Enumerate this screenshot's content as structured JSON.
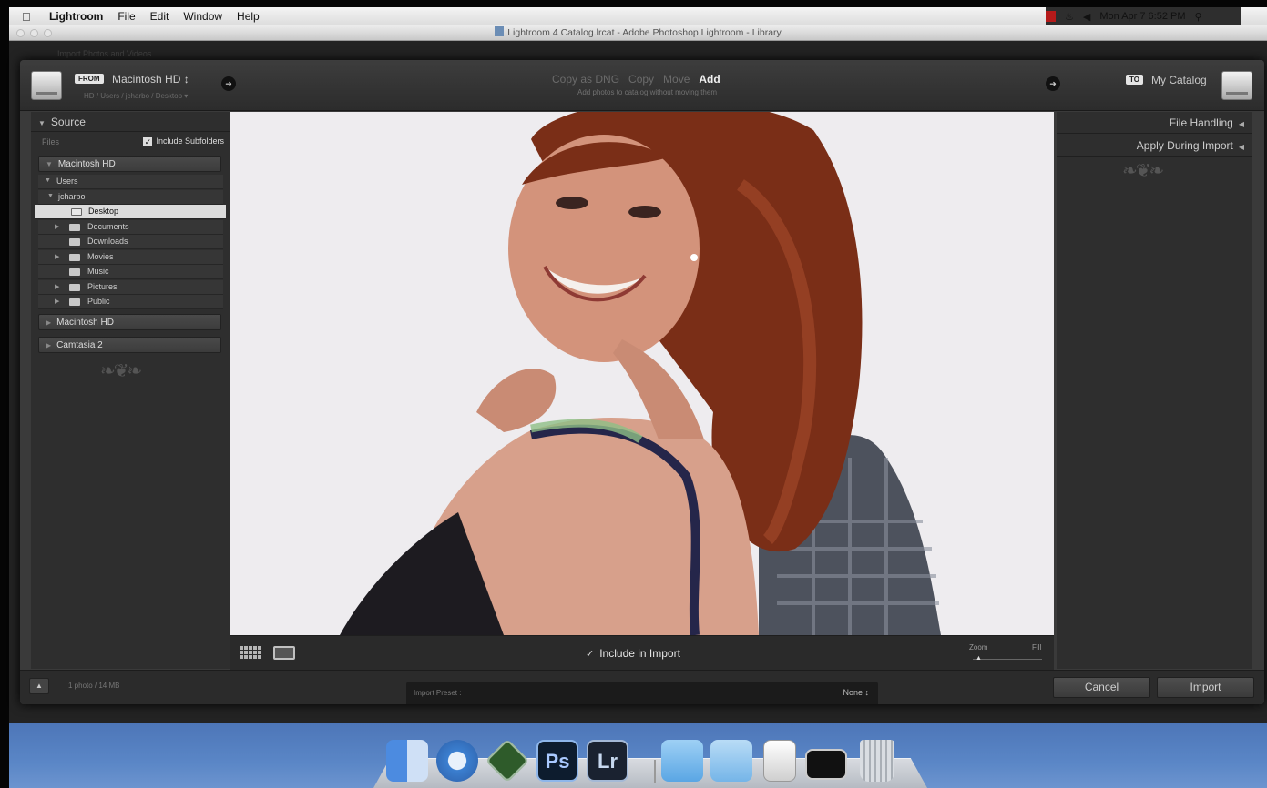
{
  "menubar": {
    "app": "Lightroom",
    "items": [
      "File",
      "Edit",
      "Window",
      "Help"
    ],
    "clock": "Mon Apr 7  6:52 PM"
  },
  "window": {
    "title": "Lightroom 4 Catalog.lrcat - Adobe Photoshop Lightroom - Library"
  },
  "backdrop": {
    "label": "Import Photos and Videos"
  },
  "import": {
    "from_tag": "FROM",
    "source_name": "Macintosh HD ↕",
    "source_path": "HD / Users / jcharbo / Desktop ▾",
    "modes": [
      "Copy as DNG",
      "Copy",
      "Move",
      "Add"
    ],
    "active_mode": "Add",
    "mode_description": "Add photos to catalog without moving them",
    "to_tag": "TO",
    "dest_name": "My Catalog"
  },
  "source_panel": {
    "title": "Source",
    "files_label": "Files",
    "include_subfolders": "Include Subfolders",
    "volumes": {
      "vol1": "Macintosh HD",
      "vol2": "Macintosh HD",
      "vol3": "Camtasia 2"
    },
    "tree": {
      "users": "Users",
      "user": "jcharbo",
      "desktop": "Desktop",
      "documents": "Documents",
      "downloads": "Downloads",
      "movies": "Movies",
      "music": "Music",
      "pictures": "Pictures",
      "public": "Public"
    }
  },
  "preview": {
    "include_label": "Include in Import",
    "zoom_label": "Zoom",
    "fill_label": "Fill"
  },
  "right_panel": {
    "file_handling": "File Handling",
    "apply_during_import": "Apply During Import"
  },
  "bottom": {
    "count": "1 photo / 14 MB",
    "preset_label": "Import Preset :",
    "preset_value": "None ↕",
    "cancel": "Cancel",
    "import": "Import"
  },
  "dock": {
    "ps": "Ps",
    "lr": "Lr"
  },
  "colors": {
    "panel": "#2e2e2e",
    "preview_bg": "#eeecef",
    "hair": "#8b3a1f",
    "dock": "#5a86c6"
  }
}
